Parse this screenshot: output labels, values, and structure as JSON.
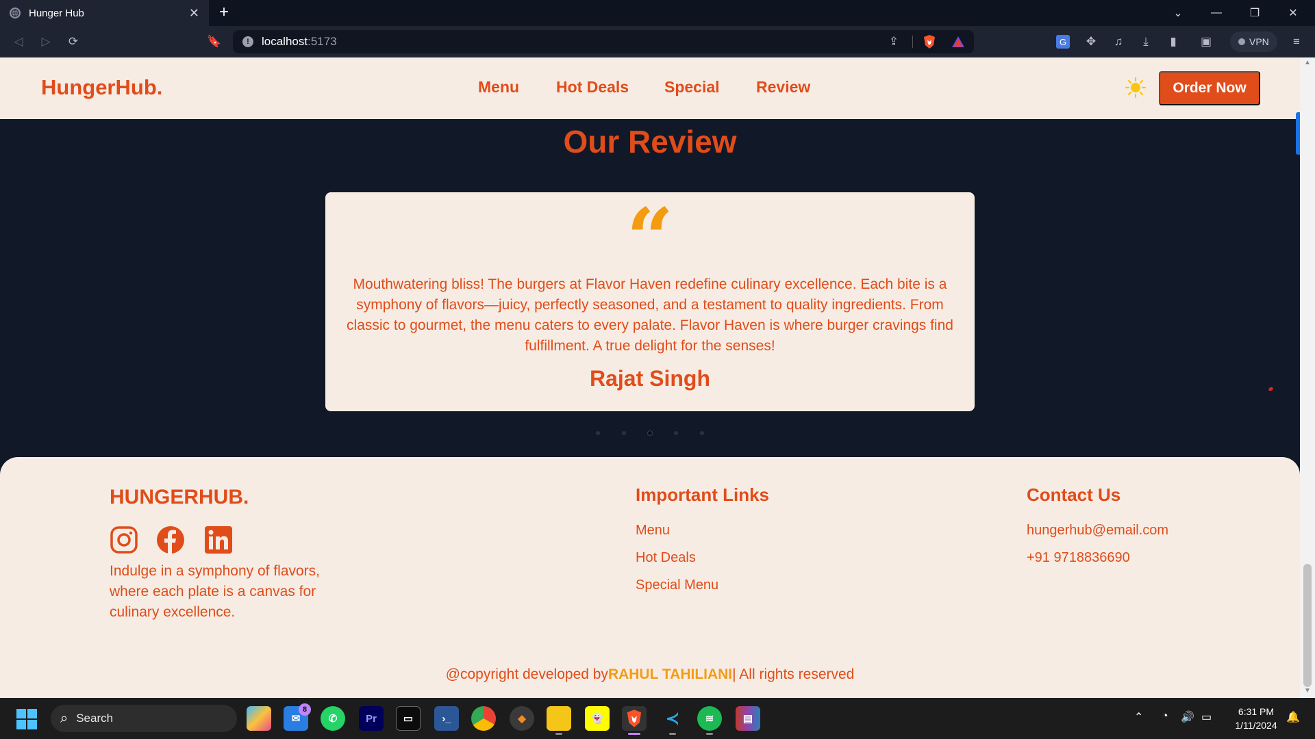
{
  "browser": {
    "tab_title": "Hunger Hub",
    "url_host": "localhost",
    "url_port": ":5173",
    "vpn_label": "VPN"
  },
  "site": {
    "logo": "HungerHub.",
    "nav": [
      "Menu",
      "Hot Deals",
      "Special",
      "Review"
    ],
    "cta": "Order Now"
  },
  "review": {
    "heading": "Our Review",
    "quote_mark": "“",
    "text": "Mouthwatering bliss! The burgers at Flavor Haven redefine culinary excellence. Each bite is a symphony of flavors—juicy, perfectly seasoned, and a testament to quality ingredients. From classic to gourmet, the menu caters to every palate. Flavor Haven is where burger cravings find fulfillment. A true delight for the senses!",
    "author": "Rajat Singh",
    "slide_count": 5,
    "active_slide": 3
  },
  "footer": {
    "brand": "HUNGERHUB.",
    "social": [
      "instagram-icon",
      "facebook-icon",
      "linkedin-icon"
    ],
    "description": "Indulge in a symphony of flavors, where each plate is a canvas for culinary excellence.",
    "links_heading": "Important Links",
    "links": [
      "Menu",
      "Hot Deals",
      "Special Menu"
    ],
    "contact_heading": "Contact Us",
    "email": "hungerhub@email.com",
    "phone": "+91 9718836690",
    "copyright_prefix": "@copyright developed by",
    "copyright_author": "RAHUL TAHILIANI",
    "copyright_suffix": "| All rights reserved"
  },
  "taskbar": {
    "search_label": "Search",
    "mail_badge": "8",
    "time": "6:31 PM",
    "date": "1/11/2024"
  },
  "colors": {
    "accent": "#e04c1a",
    "accent_secondary": "#f39c12",
    "cream": "#f6ece3",
    "dark": "#111827"
  }
}
